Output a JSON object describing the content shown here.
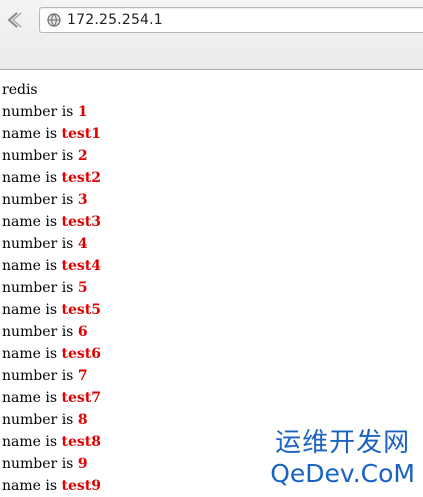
{
  "browser": {
    "url": "172.25.254.1",
    "back_icon": "back-arrow-icon",
    "site_icon": "globe-icon"
  },
  "page": {
    "heading": "redis",
    "records": [
      {
        "number_label": "number is ",
        "number": "1",
        "name_label": "name is ",
        "name": "test1"
      },
      {
        "number_label": "number is ",
        "number": "2",
        "name_label": "name is ",
        "name": "test2"
      },
      {
        "number_label": "number is ",
        "number": "3",
        "name_label": "name is ",
        "name": "test3"
      },
      {
        "number_label": "number is ",
        "number": "4",
        "name_label": "name is ",
        "name": "test4"
      },
      {
        "number_label": "number is ",
        "number": "5",
        "name_label": "name is ",
        "name": "test5"
      },
      {
        "number_label": "number is ",
        "number": "6",
        "name_label": "name is ",
        "name": "test6"
      },
      {
        "number_label": "number is ",
        "number": "7",
        "name_label": "name is ",
        "name": "test7"
      },
      {
        "number_label": "number is ",
        "number": "8",
        "name_label": "name is ",
        "name": "test8"
      },
      {
        "number_label": "number is ",
        "number": "9",
        "name_label": "name is ",
        "name": "test9"
      }
    ]
  },
  "watermark": {
    "chinese": "运维开发网",
    "english": "QeDev.CoM"
  },
  "colors": {
    "value_red": "#e00000",
    "watermark_blue": "#1a63c2"
  }
}
